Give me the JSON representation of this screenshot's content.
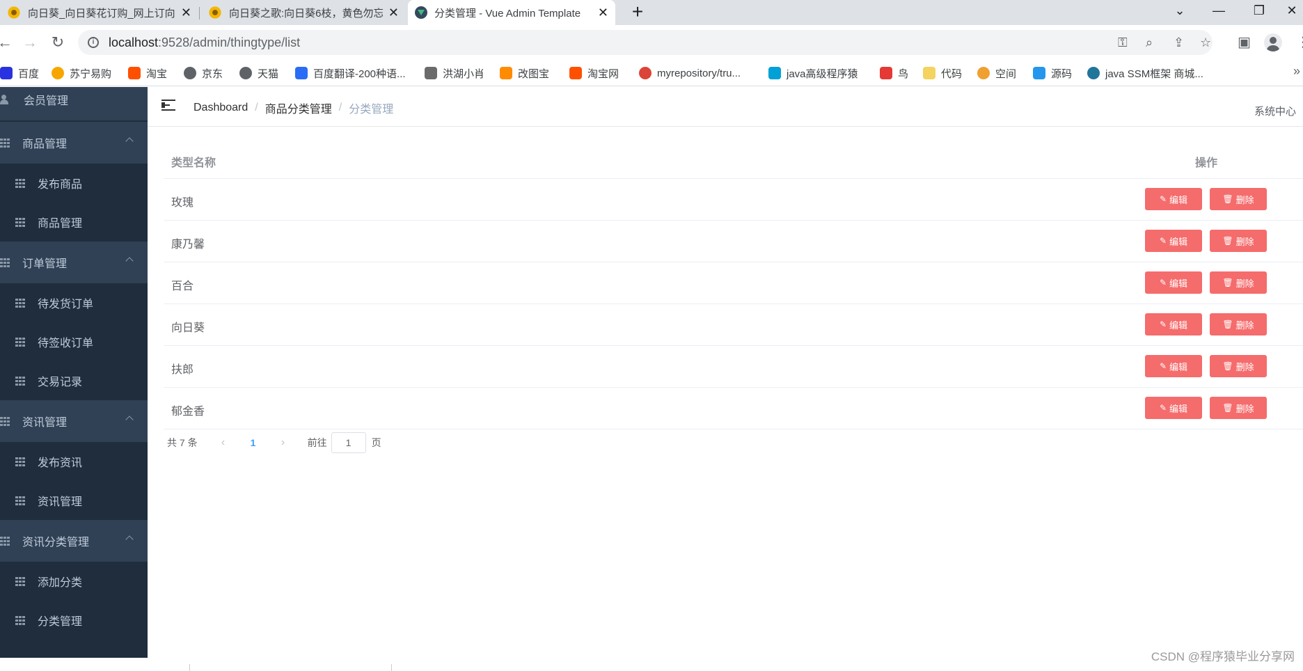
{
  "browser": {
    "tabs": [
      {
        "title": "向日葵_向日葵花订购_网上订向日葵",
        "favicon": "sunflower-icon",
        "active": false
      },
      {
        "title": "向日葵之歌:向日葵6枝，黄色勿忘",
        "favicon": "sunflower-icon",
        "active": false
      },
      {
        "title": "分类管理 - Vue Admin Template",
        "favicon": "vue-icon",
        "active": true
      }
    ],
    "new_tab": "+",
    "address": {
      "host": "localhost",
      "path": ":9528/admin/thingtype/list"
    },
    "bookmarks": [
      {
        "label": "百度",
        "icon": "baidu-icon",
        "color": "#2932e1"
      },
      {
        "label": "苏宁易购",
        "icon": "suning-icon",
        "color": "#f7a600"
      },
      {
        "label": "淘宝",
        "icon": "taobao-icon",
        "color": "#ff5000"
      },
      {
        "label": "京东",
        "icon": "globe-icon",
        "color": "#5f6368"
      },
      {
        "label": "天猫",
        "icon": "globe-icon",
        "color": "#5f6368"
      },
      {
        "label": "百度翻译-200种语...",
        "icon": "translate-icon",
        "color": "#2a6cf6"
      },
      {
        "label": "洪湖小肖",
        "icon": "bird-icon",
        "color": "#6b6b6b"
      },
      {
        "label": "改图宝",
        "icon": "gaitubao-icon",
        "color": "#ff8c00"
      },
      {
        "label": "淘宝网",
        "icon": "taobao-icon",
        "color": "#ff5000"
      },
      {
        "label": "myrepository/tru...",
        "icon": "chrome-icon",
        "color": "#db4437"
      },
      {
        "label": "java高级程序猿",
        "icon": "bilibili-icon",
        "color": "#00a1d6"
      },
      {
        "label": "鸟",
        "icon": "bird-icon",
        "color": "#e53935"
      },
      {
        "label": "代码",
        "icon": "code-icon",
        "color": "#f4d35e"
      },
      {
        "label": "空间",
        "icon": "qzone-icon",
        "color": "#f0a030"
      },
      {
        "label": "源码",
        "icon": "docker-icon",
        "color": "#2496ed"
      },
      {
        "label": "java SSM框架 商城...",
        "icon": "wordpress-icon",
        "color": "#21759b"
      }
    ],
    "more": "»"
  },
  "sidebar": {
    "items": [
      {
        "label": "会员管理",
        "type": "top",
        "icon": "people-icon",
        "expanded": false
      },
      {
        "label": "商品管理",
        "type": "top",
        "icon": "table-icon",
        "expanded": true
      },
      {
        "label": "发布商品",
        "type": "sub",
        "icon": "table-icon"
      },
      {
        "label": "商品管理",
        "type": "sub",
        "icon": "table-icon"
      },
      {
        "label": "订单管理",
        "type": "top",
        "icon": "table-icon",
        "expanded": true
      },
      {
        "label": "待发货订单",
        "type": "sub",
        "icon": "table-icon"
      },
      {
        "label": "待签收订单",
        "type": "sub",
        "icon": "table-icon"
      },
      {
        "label": "交易记录",
        "type": "sub",
        "icon": "table-icon"
      },
      {
        "label": "资讯管理",
        "type": "top",
        "icon": "table-icon",
        "expanded": true
      },
      {
        "label": "发布资讯",
        "type": "sub",
        "icon": "table-icon"
      },
      {
        "label": "资讯管理",
        "type": "sub",
        "icon": "table-icon"
      },
      {
        "label": "资讯分类管理",
        "type": "top",
        "icon": "table-icon",
        "expanded": true
      },
      {
        "label": "添加分类",
        "type": "sub",
        "icon": "table-icon"
      },
      {
        "label": "分类管理",
        "type": "sub",
        "icon": "table-icon"
      }
    ]
  },
  "header": {
    "breadcrumb": [
      "Dashboard",
      "商品分类管理",
      "分类管理"
    ],
    "right_label": "系统中心"
  },
  "table": {
    "columns": [
      "类型名称",
      "操作"
    ],
    "edit_label": "编辑",
    "delete_label": "删除",
    "rows": [
      "玫瑰",
      "康乃馨",
      "百合",
      "向日葵",
      "扶郎",
      "郁金香"
    ]
  },
  "pagination": {
    "total_text": "共 7 条",
    "current_page": "1",
    "goto_label": "前往",
    "goto_value": "1",
    "page_suffix": "页"
  },
  "watermark": "CSDN @程序猿毕业分享网",
  "colors": {
    "sidebar_bg": "#1f2d3d",
    "sidebar_top_bg": "#304156",
    "danger": "#f56c6c",
    "primary": "#409eff"
  }
}
